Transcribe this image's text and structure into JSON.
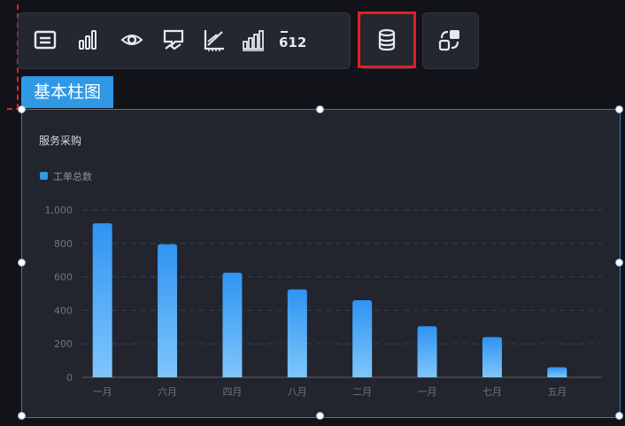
{
  "toolbar": {
    "icons": [
      "image-icon",
      "bar-chart-icon",
      "eye-target-icon",
      "comment-chart-icon",
      "axis-line-icon",
      "grouped-bar-icon",
      "number-612-icon"
    ],
    "number_label": "612",
    "data_button_icon": "database-icon",
    "link_button_icon": "linked-squares-icon"
  },
  "tag": {
    "label": "基本柱图"
  },
  "colors": {
    "accent": "#2f99e6",
    "highlight": "#e21e26",
    "panel_bg": "#22252e",
    "bar_top": "#2f94f2",
    "bar_bottom": "#7fc6fb"
  },
  "chart_data": {
    "type": "bar",
    "title": "服务采购",
    "categories": [
      "一月",
      "六月",
      "四月",
      "八月",
      "二月",
      "一月",
      "七月",
      "五月"
    ],
    "series": [
      {
        "name": "工单总数",
        "values": [
          920,
          795,
          625,
          525,
          460,
          305,
          240,
          60
        ]
      }
    ],
    "ylim": [
      0,
      1000
    ],
    "yticks": [
      "0",
      "200",
      "400",
      "600",
      "800",
      "1,000"
    ],
    "grid": true,
    "legend": "top-left"
  }
}
